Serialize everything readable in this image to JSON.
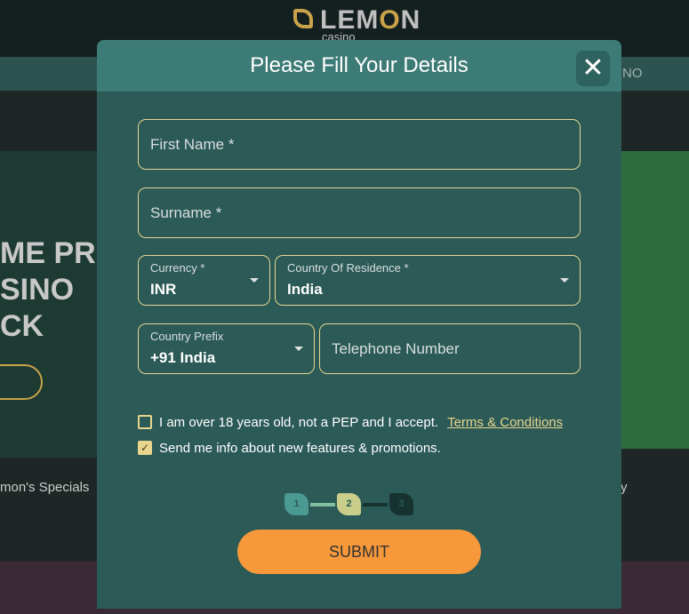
{
  "header": {
    "logo_main": "LEM",
    "logo_accent": "O",
    "logo_end": "N",
    "logo_sub": "casino",
    "nav_right": "NO"
  },
  "background": {
    "banner_lines": [
      "ME PRE",
      "SINO",
      "CK"
    ],
    "specials": "mon's Specials",
    "right_text": "y"
  },
  "modal": {
    "title": "Please Fill Your Details",
    "first_name_placeholder": "First Name *",
    "surname_placeholder": "Surname *",
    "currency": {
      "label": "Currency *",
      "value": "INR"
    },
    "country": {
      "label": "Country Of Residence *",
      "value": "India"
    },
    "prefix": {
      "label": "Country Prefix",
      "value": "+91 India"
    },
    "telephone_placeholder": "Telephone Number",
    "age_check": {
      "text": "I am over 18 years old, not a PEP and I accept.",
      "link": "Terms & Conditions",
      "checked": false
    },
    "promo_check": {
      "text": "Send me info about new features & promotions.",
      "checked": true
    },
    "steps": [
      "1",
      "2",
      "3"
    ],
    "current_step": 2,
    "submit": "SUBMIT"
  },
  "colors": {
    "accent": "#e8d58e",
    "submit": "#f7993a",
    "modal": "#2b5a57"
  }
}
